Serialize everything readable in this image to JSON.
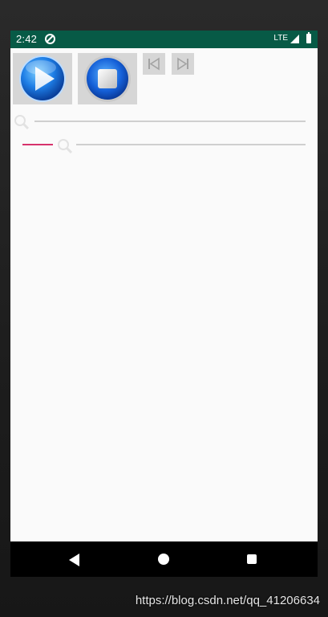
{
  "status_bar": {
    "time": "2:42",
    "network": "LTE",
    "icons": [
      "app-notification-icon",
      "signal-icon",
      "battery-icon"
    ],
    "background": "#075a46"
  },
  "controls": {
    "play_button": {
      "icon": "play-icon"
    },
    "stop_button": {
      "icon": "stop-icon"
    },
    "prev_button": {
      "icon": "skip-previous-icon"
    },
    "next_button": {
      "icon": "skip-next-icon"
    }
  },
  "seekbars": [
    {
      "name": "seekbar-1",
      "thumb_icon": "magnifier-icon",
      "progress": 0.0
    },
    {
      "name": "seekbar-2",
      "thumb_icon": "magnifier-icon",
      "progress": 0.1,
      "progress_color": "#d6336c"
    }
  ],
  "nav_bar": {
    "buttons": [
      "back-icon",
      "home-icon",
      "recents-icon"
    ]
  },
  "watermark": "https://blog.csdn.net/qq_41206634"
}
